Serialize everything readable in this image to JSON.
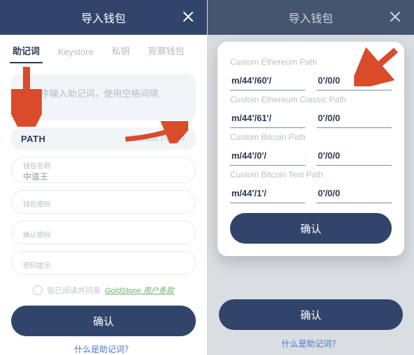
{
  "header": {
    "title": "导入钱包"
  },
  "tabs": {
    "items": [
      {
        "label": "助记词",
        "active": true
      },
      {
        "label": "Keystore"
      },
      {
        "label": "私钥"
      },
      {
        "label": "观察钱包"
      }
    ]
  },
  "left": {
    "mnemonic_placeholder": "按顺序输入助记词，使用空格间隔",
    "path_label": "PATH",
    "path_value": "Default Path",
    "fields": {
      "name_label": "钱包名称",
      "name_value": "中道王",
      "password_label": "钱包密码",
      "confirm_label": "确认密码",
      "hint_label": "密码提示"
    },
    "tos_prefix": "我已阅读并同意",
    "tos_link": "GoldStone 用户条款",
    "confirm_btn": "确认",
    "footer_link": "什么是助记词？"
  },
  "right": {
    "under_confirm_btn": "确认",
    "under_footer_link": "什么是助记词？"
  },
  "popup": {
    "sections": [
      {
        "title": "Custom Ethereum Path",
        "left": "m/44'/60'/",
        "right": "0'/0/0"
      },
      {
        "title": "Custom Ethereum Classic Path",
        "left": "m/44'/61'/",
        "right": "0'/0/0"
      },
      {
        "title": "Custom Bitcoin Path",
        "left": "m/44'/0'/",
        "right": "0'/0/0"
      },
      {
        "title": "Custom Bitcoin Test Path",
        "left": "m/44'/1'/",
        "right": "0'/0/0"
      }
    ],
    "confirm_btn": "确认"
  }
}
